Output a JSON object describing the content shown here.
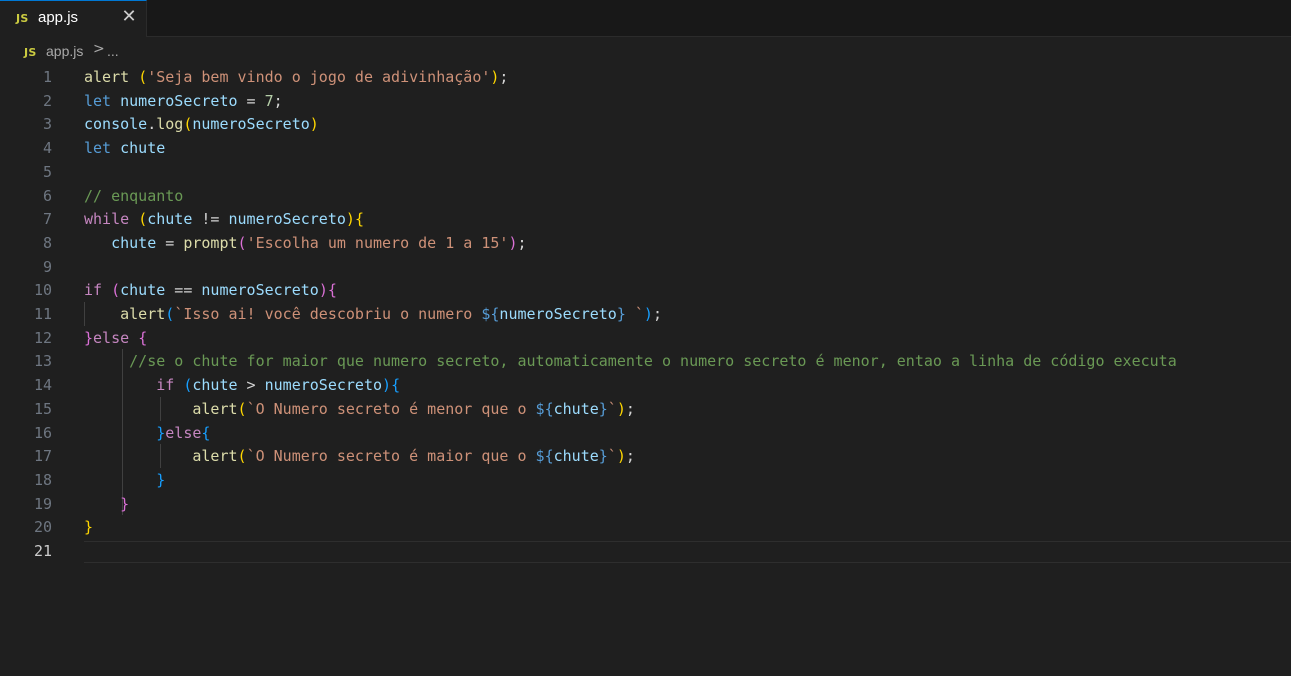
{
  "tab": {
    "badge": "JS",
    "filename": "app.js",
    "close_icon": "close-icon"
  },
  "breadcrumb": {
    "badge": "JS",
    "file": "app.js",
    "separator": ">",
    "ellipsis": "..."
  },
  "editor": {
    "active_line": 21,
    "line_numbers": [
      "1",
      "2",
      "3",
      "4",
      "5",
      "6",
      "7",
      "8",
      "9",
      "10",
      "11",
      "12",
      "13",
      "14",
      "15",
      "16",
      "17",
      "18",
      "19",
      "20",
      "21"
    ],
    "lines": [
      [
        [
          "fn",
          "alert"
        ],
        [
          "plain",
          " "
        ],
        [
          "b1",
          "("
        ],
        [
          "str",
          "'Seja bem vindo o jogo de adivinhação'"
        ],
        [
          "b1",
          ")"
        ],
        [
          "plain",
          ";"
        ]
      ],
      [
        [
          "kw",
          "let"
        ],
        [
          "plain",
          " "
        ],
        [
          "var",
          "numeroSecreto"
        ],
        [
          "plain",
          " = "
        ],
        [
          "num",
          "7"
        ],
        [
          "plain",
          ";"
        ]
      ],
      [
        [
          "var",
          "console"
        ],
        [
          "plain",
          "."
        ],
        [
          "fn",
          "log"
        ],
        [
          "b1",
          "("
        ],
        [
          "var",
          "numeroSecreto"
        ],
        [
          "b1",
          ")"
        ]
      ],
      [
        [
          "kw",
          "let"
        ],
        [
          "plain",
          " "
        ],
        [
          "var",
          "chute"
        ]
      ],
      [],
      [
        [
          "cm",
          "// enquanto"
        ]
      ],
      [
        [
          "ctl",
          "while"
        ],
        [
          "plain",
          " "
        ],
        [
          "b1",
          "("
        ],
        [
          "var",
          "chute"
        ],
        [
          "plain",
          " != "
        ],
        [
          "var",
          "numeroSecreto"
        ],
        [
          "b1",
          ")"
        ],
        [
          "b1",
          "{"
        ]
      ],
      [
        [
          "plain",
          "   "
        ],
        [
          "var",
          "chute"
        ],
        [
          "plain",
          " = "
        ],
        [
          "fn",
          "prompt"
        ],
        [
          "b2",
          "("
        ],
        [
          "str",
          "'Escolha um numero de 1 a 15'"
        ],
        [
          "b2",
          ")"
        ],
        [
          "plain",
          ";"
        ]
      ],
      [],
      [
        [
          "ctl",
          "if"
        ],
        [
          "plain",
          " "
        ],
        [
          "b2",
          "("
        ],
        [
          "var",
          "chute"
        ],
        [
          "plain",
          " == "
        ],
        [
          "var",
          "numeroSecreto"
        ],
        [
          "b2",
          ")"
        ],
        [
          "b2",
          "{"
        ]
      ],
      [
        [
          "plain",
          "    "
        ],
        [
          "fn",
          "alert"
        ],
        [
          "b3",
          "("
        ],
        [
          "str",
          "`Isso ai! você descobriu o numero "
        ],
        [
          "tpl",
          "${"
        ],
        [
          "var",
          "numeroSecreto"
        ],
        [
          "tpl",
          "}"
        ],
        [
          "str",
          " `"
        ],
        [
          "b3",
          ")"
        ],
        [
          "plain",
          ";"
        ]
      ],
      [
        [
          "b2",
          "}"
        ],
        [
          "ctl",
          "else"
        ],
        [
          "plain",
          " "
        ],
        [
          "b2",
          "{"
        ]
      ],
      [
        [
          "plain",
          "     "
        ],
        [
          "cm",
          "//se o chute for maior que numero secreto, automaticamente o numero secreto é menor, entao a linha de código executa"
        ]
      ],
      [
        [
          "plain",
          "        "
        ],
        [
          "ctl",
          "if"
        ],
        [
          "plain",
          " "
        ],
        [
          "b3",
          "("
        ],
        [
          "var",
          "chute"
        ],
        [
          "plain",
          " > "
        ],
        [
          "var",
          "numeroSecreto"
        ],
        [
          "b3",
          ")"
        ],
        [
          "b3",
          "{"
        ]
      ],
      [
        [
          "plain",
          "            "
        ],
        [
          "fn",
          "alert"
        ],
        [
          "b1",
          "("
        ],
        [
          "str",
          "`O Numero secreto é menor que o "
        ],
        [
          "tpl",
          "${"
        ],
        [
          "var",
          "chute"
        ],
        [
          "tpl",
          "}"
        ],
        [
          "str",
          "`"
        ],
        [
          "b1",
          ")"
        ],
        [
          "plain",
          ";"
        ]
      ],
      [
        [
          "plain",
          "        "
        ],
        [
          "b3",
          "}"
        ],
        [
          "ctl",
          "else"
        ],
        [
          "b3",
          "{"
        ]
      ],
      [
        [
          "plain",
          "            "
        ],
        [
          "fn",
          "alert"
        ],
        [
          "b1",
          "("
        ],
        [
          "str",
          "`O Numero secreto é maior que o "
        ],
        [
          "tpl",
          "${"
        ],
        [
          "var",
          "chute"
        ],
        [
          "tpl",
          "}"
        ],
        [
          "str",
          "`"
        ],
        [
          "b1",
          ")"
        ],
        [
          "plain",
          ";"
        ]
      ],
      [
        [
          "plain",
          "        "
        ],
        [
          "b3",
          "}"
        ]
      ],
      [
        [
          "plain",
          "    "
        ],
        [
          "b2",
          "}"
        ]
      ],
      [
        [
          "b1",
          "}"
        ]
      ],
      []
    ]
  }
}
